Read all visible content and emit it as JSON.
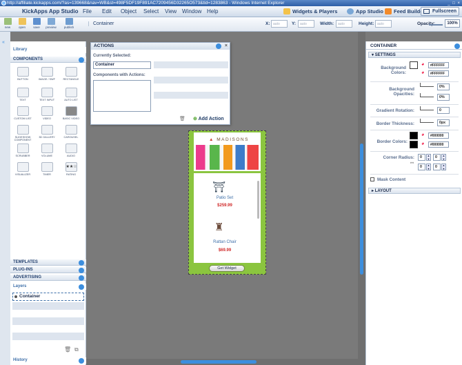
{
  "window": {
    "title": "http://affiliate.kickapps.com/?as=139668&nav=WB&st=498F5DF19F891AC7209456D32265O573&tid=1283863 - Windows Internet Explorer",
    "controls": "_ □ ×"
  },
  "menubar": {
    "app_name": "KickApps App Studio",
    "items": [
      "File",
      "Edit",
      "Object",
      "Select",
      "View",
      "Window",
      "Help"
    ],
    "tabs": [
      "Widgets & Players",
      "App Studio",
      "Feed Builder"
    ],
    "fullscreen": "Fullscreen"
  },
  "toolbar": {
    "buttons": [
      "new",
      "open",
      "save",
      "preview",
      "publish"
    ],
    "selection": "Container",
    "x_label": "X:",
    "y_label": "Y:",
    "width_label": "Width:",
    "height_label": "Height:",
    "x_value": "auto",
    "y_value": "auto",
    "width_value": "auto",
    "height_value": "auto",
    "opacity_label": "Opacity:",
    "opacity_value": "100%"
  },
  "library": {
    "title": "Library",
    "components_header": "COMPONENTS",
    "components": [
      {
        "label": "BUTTON"
      },
      {
        "label": "IMAGE / SWF"
      },
      {
        "label": "RECTANGLE"
      },
      {
        "label": "TEXT"
      },
      {
        "label": "TEXT INPUT"
      },
      {
        "label": "AUTO LIST"
      },
      {
        "label": "CUSTOM LIST"
      },
      {
        "label": "VIDEO"
      },
      {
        "label": "BASIC VIDEO"
      },
      {
        "label": "SLIDESHOW COMPONENT"
      },
      {
        "label": "3D GALLERY"
      },
      {
        "label": "CAROUSEL"
      },
      {
        "label": "SCRUBBER"
      },
      {
        "label": "VOLUME"
      },
      {
        "label": "AUDIO"
      },
      {
        "label": "VISUALIZER"
      },
      {
        "label": "TIMER"
      },
      {
        "label": "RATING"
      }
    ],
    "sections": [
      "TEMPLATES",
      "PLUG-INS",
      "ADVERTISING"
    ],
    "layers_title": "Layers",
    "layers": [
      "Container"
    ],
    "history_title": "History"
  },
  "actions_panel": {
    "title": "ACTIONS",
    "currently_selected_label": "Currently Selected:",
    "currently_selected_value": "Container",
    "components_with_actions_label": "Components with Actions:",
    "add_action": "Add Action"
  },
  "widget": {
    "brand": "MADISONS",
    "products": [
      {
        "name": "Patio Set",
        "price": "$259.99"
      },
      {
        "name": "Rattan Chair",
        "price": "$69.99"
      }
    ],
    "get_widget": "Get Widget"
  },
  "properties": {
    "panel_title": "CONTAINER",
    "settings_header": "SETTINGS",
    "background_colors_label": "Background Colors:",
    "background_colors": [
      "#FFFFFF",
      "#FFFFFF"
    ],
    "background_opacities_label": "Background Opacities:",
    "background_opacities": [
      "0%",
      "0%"
    ],
    "gradient_rotation_label": "Gradient Rotation:",
    "gradient_rotation": "0",
    "border_thickness_label": "Border Thickness:",
    "border_thickness": "0px",
    "border_colors_label": "Border Colors:",
    "border_colors": [
      "#000000",
      "#000000"
    ],
    "corner_radius_label": "Corner Radius:",
    "corner_radius": [
      "0",
      "0",
      "0",
      "0"
    ],
    "mask_content_label": "Mask Content",
    "layout_header": "LAYOUT"
  },
  "colors": {
    "stage_green": "#8bc53f",
    "price_red": "#d02a2a",
    "accent_blue": "#3c8ede"
  }
}
